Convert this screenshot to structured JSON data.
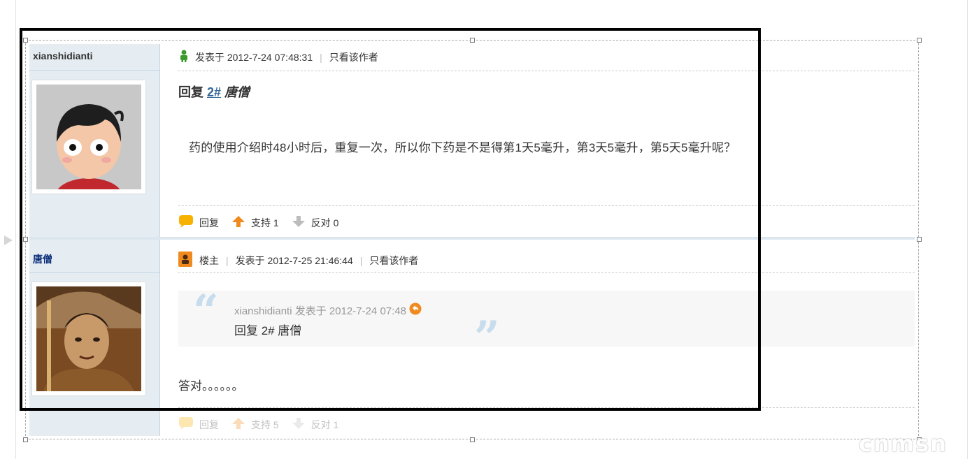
{
  "posts": [
    {
      "username": "xianshidianti",
      "posted_at": "发表于 2012-7-24 07:48:31",
      "view_author_only": "只看该作者",
      "reply_prefix": "回复",
      "reply_floor": "2#",
      "reply_name": "唐僧",
      "body": "药的使用介绍时48小时后，重复一次，所以你下药是不是得第1天5毫升，第3天5毫升，第5天5毫升呢？",
      "actions": {
        "reply": "回复",
        "support": "支持 1",
        "oppose": "反对 0"
      }
    },
    {
      "username": "唐僧",
      "owner_badge": "楼主",
      "posted_at": "发表于 2012-7-25 21:46:44",
      "view_author_only": "只看该作者",
      "quote": {
        "meta": "xianshidianti 发表于 2012-7-24 07:48",
        "text": "回复 2# 唐僧"
      },
      "body": "答对。。。。。。",
      "actions": {
        "reply": "回复",
        "support": "支持 5",
        "oppose": "反对 1"
      }
    }
  ],
  "separator": "|",
  "watermark": "cnmsn",
  "colors": {
    "sidebar_bg": "#e5edf2",
    "link_blue": "#336699",
    "username_blue": "#0a2d7a",
    "accent_orange": "#f08a1e"
  }
}
